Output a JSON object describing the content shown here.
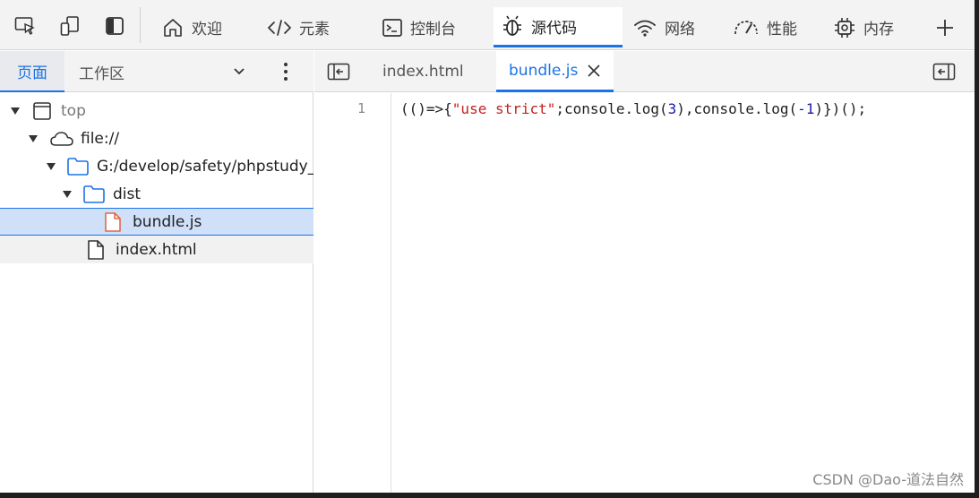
{
  "top_tabs": [
    {
      "label": "欢迎",
      "icon": "home-icon"
    },
    {
      "label": "元素",
      "icon": "code-tag-icon"
    },
    {
      "label": "控制台",
      "icon": "console-icon"
    },
    {
      "label": "源代码",
      "icon": "bug-icon",
      "active": true
    },
    {
      "label": "网络",
      "icon": "wifi-icon"
    },
    {
      "label": "性能",
      "icon": "gauge-icon"
    },
    {
      "label": "内存",
      "icon": "chip-icon"
    }
  ],
  "navigator": {
    "tabs": [
      "页面",
      "工作区"
    ],
    "tree": [
      {
        "label": "top",
        "icon": "frame-icon"
      },
      {
        "label": "file://",
        "icon": "cloud-icon"
      },
      {
        "label": "G:/develop/safety/phpstudy_",
        "icon": "folder-icon"
      },
      {
        "label": "dist",
        "icon": "folder-icon"
      },
      {
        "label": "bundle.js",
        "icon": "js-file-icon"
      },
      {
        "label": "index.html",
        "icon": "file-icon"
      }
    ]
  },
  "editor": {
    "tabs": [
      {
        "label": "index.html"
      },
      {
        "label": "bundle.js",
        "active": true
      }
    ],
    "line_number": "1",
    "code": {
      "p1": "(()=>{",
      "s1": "\"use strict\"",
      "p2": ";console.log(",
      "n1": "3",
      "p3": "),console.log(",
      "n2": "-1",
      "p4": ")})();"
    }
  },
  "watermark": "CSDN @Dao-道法自然",
  "colors": {
    "accent": "#1a73e8",
    "selected_row": "#cfe0f8",
    "string": "#c5221f",
    "number": "#1a1aa6"
  }
}
